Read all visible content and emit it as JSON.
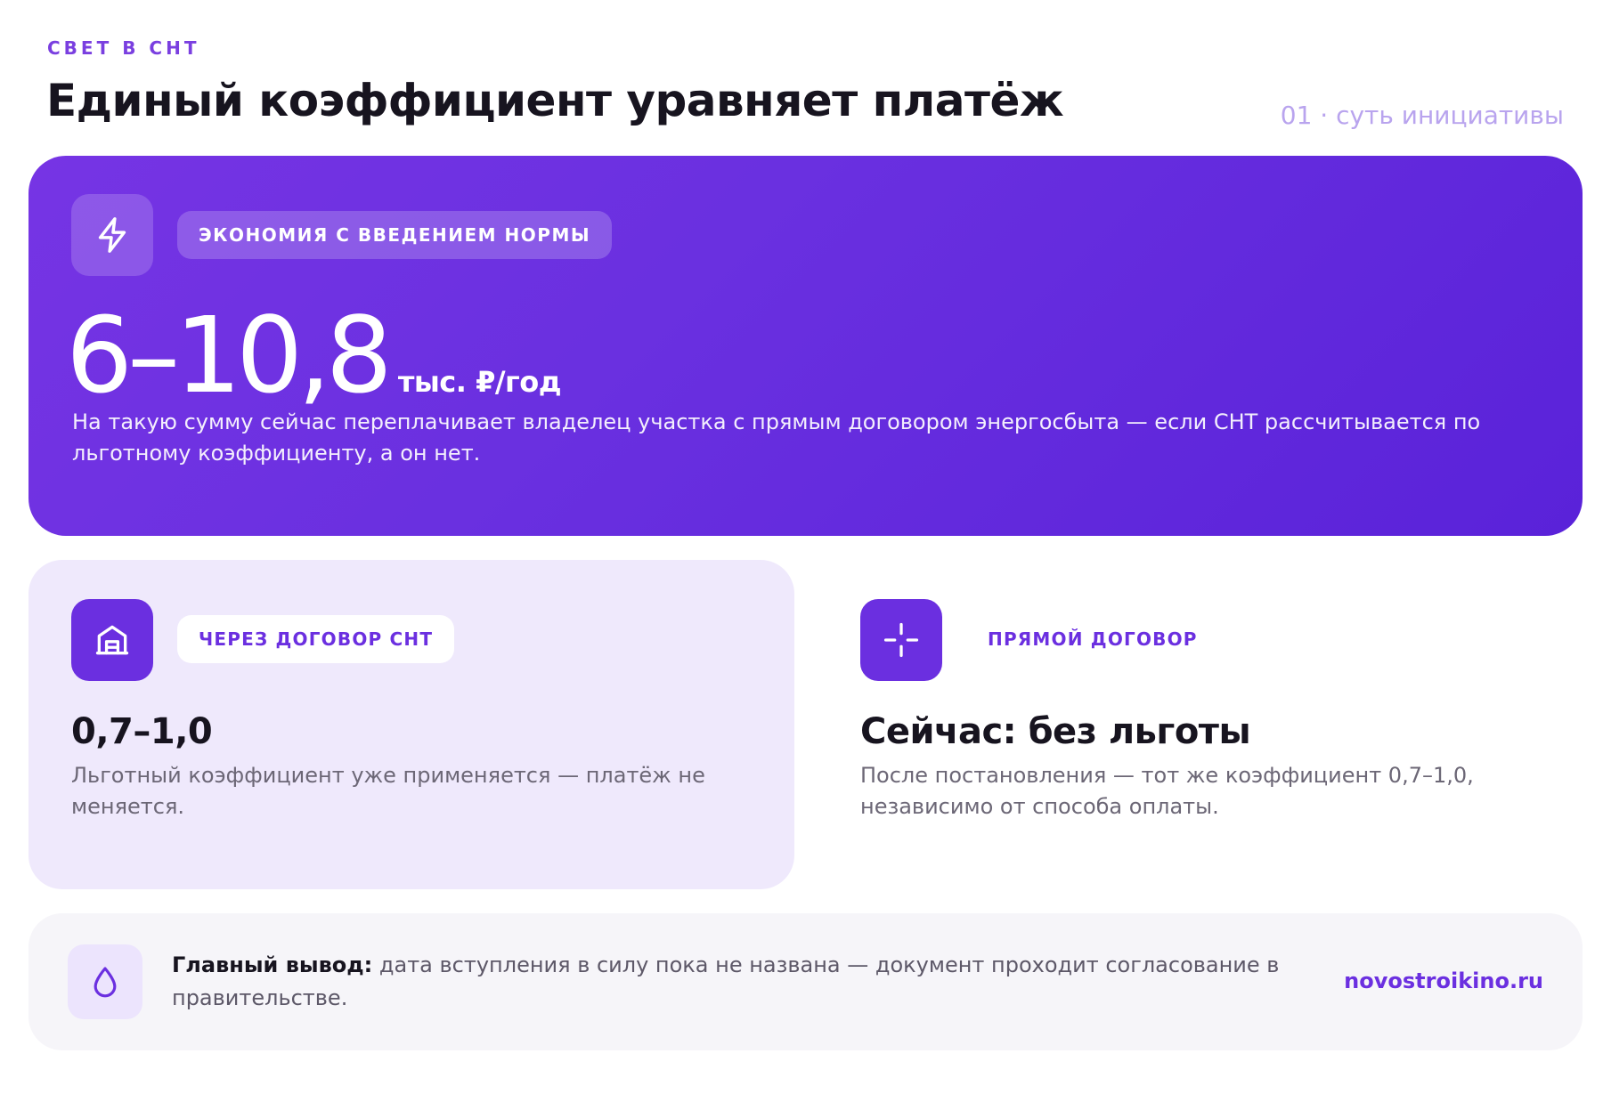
{
  "header": {
    "kicker": "СВЕТ В СНТ",
    "title": "Единый коэффициент уравняет платёж",
    "page_label": "01 · суть инициативы"
  },
  "hero": {
    "icon": "lightning-icon",
    "pill": "ЭКОНОМИЯ С ВВЕДЕНИЕМ НОРМЫ",
    "value": "6–10,8",
    "unit": "тыс. ₽/год",
    "description": "На такую сумму сейчас переплачивает владелец участка с прямым договором энергосбыта — если СНТ рассчитывается по льготному коэффициенту, а он нет."
  },
  "cards": [
    {
      "icon": "house-icon",
      "pill": "ЧЕРЕЗ ДОГОВОР СНТ",
      "value": "0,7–1,0",
      "description": "Льготный коэффициент уже применяется — платёж не меняется."
    },
    {
      "icon": "crosshair-icon",
      "pill": "ПРЯМОЙ ДОГОВОР",
      "value": "Сейчас: без льготы",
      "description": "После постановления — тот же коэффициент 0,7–1,0, независимо от способа оплаты."
    }
  ],
  "footer": {
    "icon": "drop-icon",
    "label": "Главный вывод:",
    "text": " дата вступления в силу пока не названа — документ проходит согласование в правительстве.",
    "site": "novostroikino.ru"
  },
  "colors": {
    "accent": "#6b2fe0",
    "hero_start": "#7634e4",
    "hero_end": "#5a22d9",
    "card_bg": "#efe9fc",
    "footer_bg": "#f6f5f9"
  }
}
